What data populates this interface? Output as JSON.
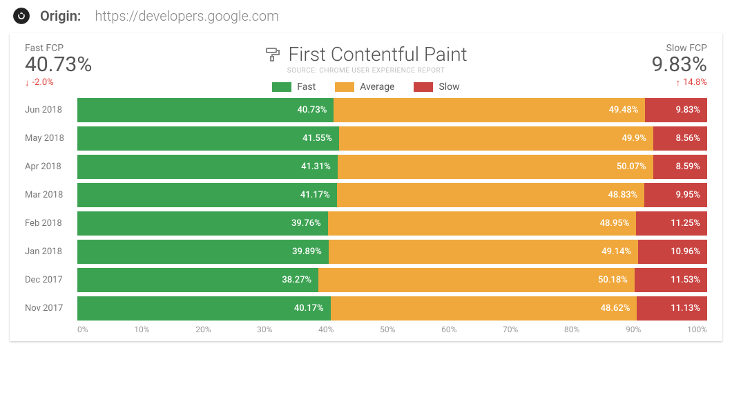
{
  "topbar": {
    "origin_label": "Origin:",
    "origin_url": "https://developers.google.com"
  },
  "title": "First Contentful Paint",
  "subtitle": "SOURCE: CHROME USER EXPERIENCE REPORT",
  "legend": {
    "fast": "Fast",
    "average": "Average",
    "slow": "Slow"
  },
  "kpi_left": {
    "label": "Fast FCP",
    "value": "40.73%",
    "delta": "-2.0%",
    "direction": "down"
  },
  "kpi_right": {
    "label": "Slow FCP",
    "value": "9.83%",
    "delta": "14.8%",
    "direction": "up"
  },
  "colors": {
    "fast": "#3BA251",
    "average": "#F0A83C",
    "slow": "#C94341",
    "delta": "#E2443E"
  },
  "axis_ticks": [
    "0%",
    "10%",
    "20%",
    "30%",
    "40%",
    "50%",
    "60%",
    "70%",
    "80%",
    "90%",
    "100%"
  ],
  "chart_data": {
    "type": "bar",
    "title": "First Contentful Paint",
    "xlabel": "",
    "ylabel": "",
    "xlim": [
      0,
      100
    ],
    "categories": [
      "Jun 2018",
      "May 2018",
      "Apr 2018",
      "Mar 2018",
      "Feb 2018",
      "Jan 2018",
      "Dec 2017",
      "Nov 2017"
    ],
    "series": [
      {
        "name": "Fast",
        "values": [
          40.73,
          41.55,
          41.31,
          41.17,
          39.76,
          39.89,
          38.27,
          40.17
        ]
      },
      {
        "name": "Average",
        "values": [
          49.48,
          49.9,
          50.07,
          48.83,
          48.95,
          49.14,
          50.18,
          48.62
        ]
      },
      {
        "name": "Slow",
        "values": [
          9.83,
          8.56,
          8.59,
          9.95,
          11.25,
          10.96,
          11.53,
          11.13
        ]
      }
    ]
  }
}
